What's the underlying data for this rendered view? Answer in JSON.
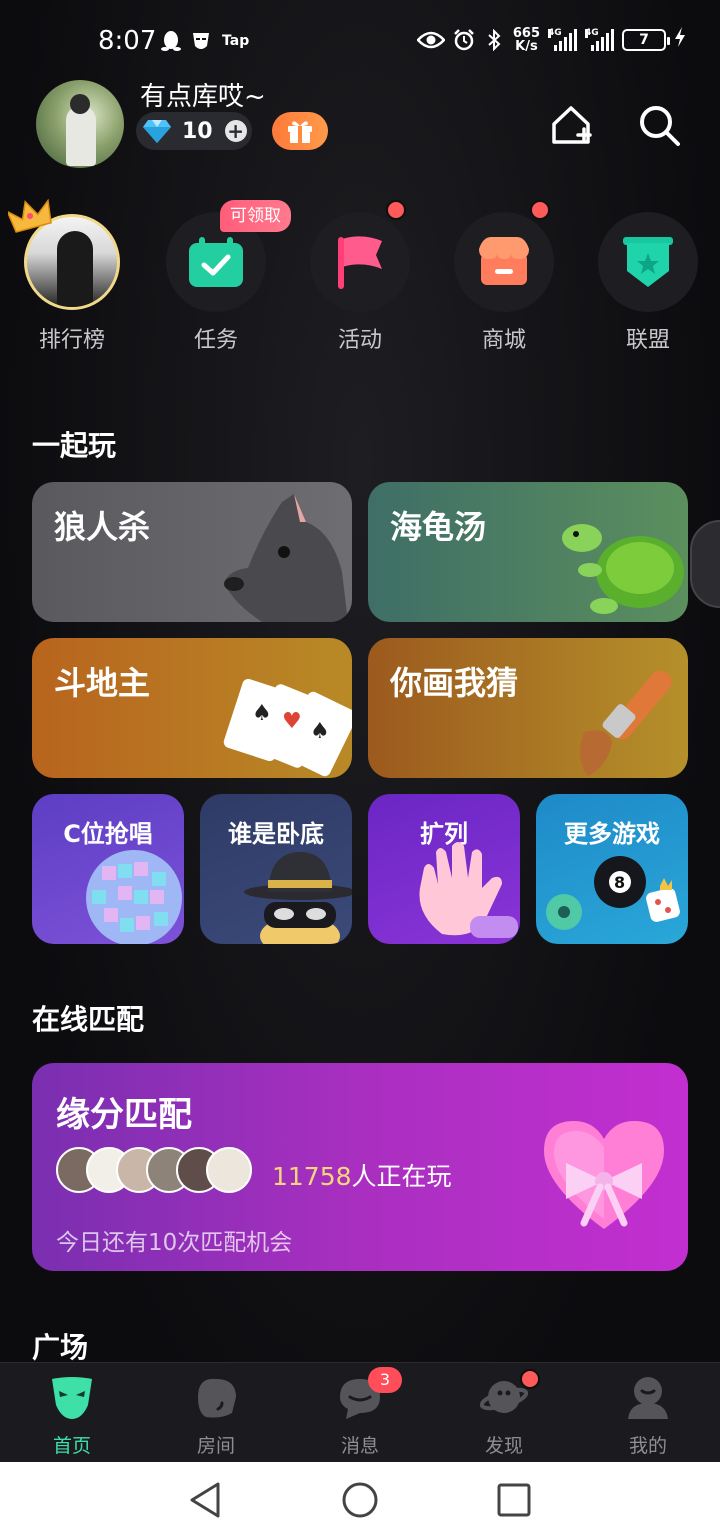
{
  "status_bar": {
    "time": "8:07",
    "tap_label": "Tap",
    "net_speed_top": "665",
    "net_speed_bottom": "K/s",
    "signal_label": "4G",
    "battery": "7"
  },
  "profile": {
    "username": "有点库哎~",
    "diamonds": "10"
  },
  "quick_links": [
    {
      "label": "排行榜"
    },
    {
      "label": "任务",
      "badge": "可领取"
    },
    {
      "label": "活动"
    },
    {
      "label": "商城"
    },
    {
      "label": "联盟"
    }
  ],
  "play_together": {
    "title": "一起玩",
    "games": [
      {
        "label": "狼人杀"
      },
      {
        "label": "海龟汤"
      },
      {
        "label": "斗地主"
      },
      {
        "label": "你画我猜"
      },
      {
        "label": "C位抢唱"
      },
      {
        "label": "谁是卧底"
      },
      {
        "label": "扩列"
      },
      {
        "label": "更多游戏"
      }
    ]
  },
  "online_match": {
    "title": "在线匹配",
    "card_title": "缘分匹配",
    "player_count": "11758",
    "player_suffix": "人正在玩",
    "remaining_note": "今日还有10次匹配机会"
  },
  "plaza": {
    "title": "广场"
  },
  "bottom_nav": {
    "items": [
      {
        "label": "首页",
        "icon": "mask-icon",
        "active": true
      },
      {
        "label": "房间",
        "icon": "room-icon"
      },
      {
        "label": "消息",
        "icon": "message-icon",
        "badge": "3"
      },
      {
        "label": "发现",
        "icon": "planet-icon"
      },
      {
        "label": "我的",
        "icon": "profile-icon"
      }
    ]
  },
  "colors": {
    "accent": "#3ee0a8",
    "badge_red": "#ff4d5a",
    "match_gradient_start": "#7a2fb0",
    "match_gradient_end": "#c22fd0"
  }
}
